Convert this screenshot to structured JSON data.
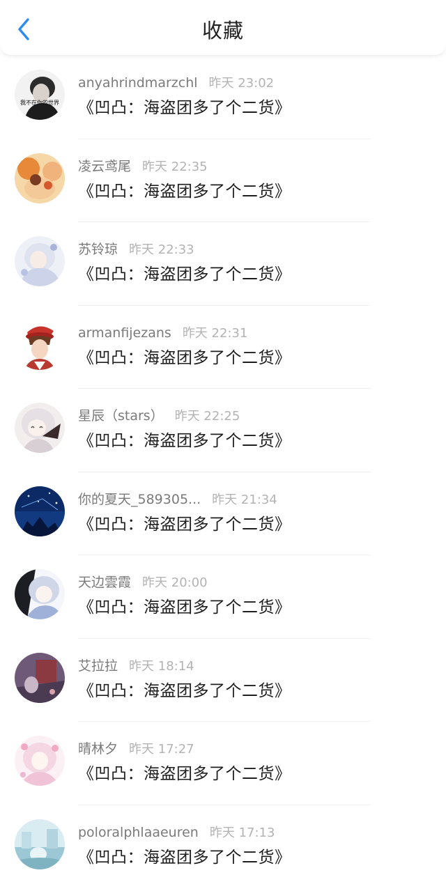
{
  "header": {
    "title": "收藏",
    "back_icon": "chevron-left-icon",
    "accent_color": "#2b8cf2"
  },
  "items": [
    {
      "username": "anyahrindmarzchl",
      "time": "昨天 23:02",
      "title": "《凹凸：海盗团多了个二货》",
      "avatar_text": "我不在你的世界"
    },
    {
      "username": "凌云鸢尾",
      "time": "昨天 22:35",
      "title": "《凹凸：海盗团多了个二货》"
    },
    {
      "username": "苏铃琼",
      "time": "昨天 22:33",
      "title": "《凹凸：海盗团多了个二货》"
    },
    {
      "username": "armanfijezans",
      "time": "昨天 22:31",
      "title": "《凹凸：海盗团多了个二货》"
    },
    {
      "username": "星辰（stars）",
      "time": "昨天 22:25",
      "title": "《凹凸：海盗团多了个二货》"
    },
    {
      "username": "你的夏天_589305...",
      "time": "昨天 21:34",
      "title": "《凹凸：海盗团多了个二货》"
    },
    {
      "username": "天边雲霞",
      "time": "昨天 20:00",
      "title": "《凹凸：海盗团多了个二货》"
    },
    {
      "username": "艾拉拉",
      "time": "昨天 18:14",
      "title": "《凹凸：海盗团多了个二货》"
    },
    {
      "username": "晴林夕",
      "time": "昨天 17:27",
      "title": "《凹凸：海盗团多了个二货》"
    },
    {
      "username": "poloralphlaaeuren",
      "time": "昨天 17:13",
      "title": "《凹凸：海盗团多了个二货》"
    }
  ]
}
